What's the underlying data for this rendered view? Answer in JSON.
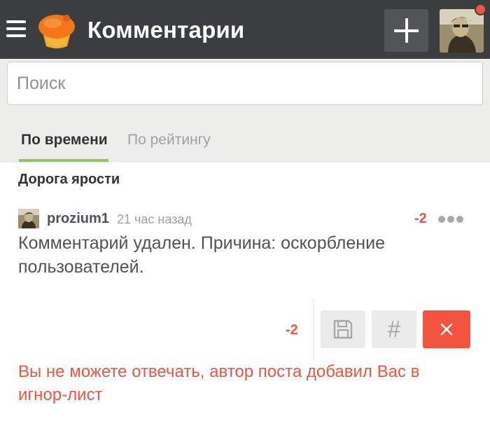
{
  "header": {
    "title": "Комментарии",
    "menu_icon": "hamburger-menu-icon",
    "logo_icon": "cupcake-logo",
    "add_icon": "plus-icon",
    "avatar_icon": "user-avatar"
  },
  "search": {
    "placeholder": "Поиск",
    "value": ""
  },
  "tabs": [
    {
      "label": "По времени",
      "active": true
    },
    {
      "label": "По рейтингу",
      "active": false
    }
  ],
  "post": {
    "title": "Дорога ярости"
  },
  "comment": {
    "author": "prozium1",
    "time": "21 час назад",
    "rating": "-2",
    "text": "Комментарий удален. Причина: оскорбление пользователей.",
    "more_icon": "more-dots-icon"
  },
  "actions": {
    "rating": "-2",
    "save_icon": "save-icon",
    "hash_label": "#",
    "close_icon": "close-icon"
  },
  "notice": {
    "ignore_message": "Вы не можете отвечать, автор поста добавил Вас в игнор-лист"
  },
  "colors": {
    "header_bg": "#3c3d3f",
    "accent_green": "#8ac858",
    "negative_red": "#f2543f",
    "panel_bg": "#edeeec"
  }
}
